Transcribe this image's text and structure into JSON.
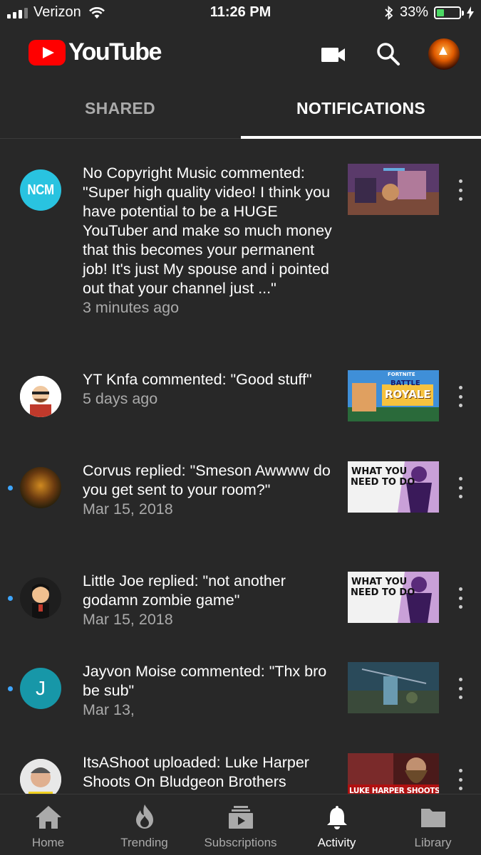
{
  "status_bar": {
    "carrier": "Verizon",
    "time": "11:26 PM",
    "battery_text": "33%",
    "battery_level": 0.33
  },
  "header": {
    "logo_text": "YouTube",
    "camera_icon": "video-camera-icon",
    "search_icon": "search-icon"
  },
  "tabs": [
    {
      "label": "SHARED",
      "active": false
    },
    {
      "label": "NOTIFICATIONS",
      "active": true
    }
  ],
  "notifications": [
    {
      "text": "No Copyright Music commented: \"Super high quality video! I think you have potential to be a HUGE YouTuber and make so much money that this becomes your permanent job! It's just My spouse and i pointed out that your channel just ...\"",
      "time": "3 minutes ago",
      "avatar_text": "NCM",
      "unread": false
    },
    {
      "text": "YT Knfa commented: \"Good stuff\"",
      "time": "5 days ago",
      "unread": false,
      "thumb_lines": [
        "FORTNITE",
        "BATTLE",
        "ROYALE"
      ]
    },
    {
      "text": "Corvus replied: \"Smeson Awwww do you get sent to your room?\"",
      "time": "Mar 15, 2018",
      "unread": true,
      "thumb_lines": [
        "WHAT YOU",
        "NEED TO DO"
      ]
    },
    {
      "text": "Little Joe replied: \"not another godamn zombie game\"",
      "time": "Mar 15, 2018",
      "unread": true,
      "thumb_lines": [
        "WHAT YOU",
        "NEED TO DO"
      ]
    },
    {
      "text": "Jayvon Moise commented: \"Thx bro be sub\"",
      "time": "Mar 13,",
      "avatar_text": "J",
      "unread": true
    },
    {
      "text": "ItsAShoot uploaded: Luke Harper Shoots On Bludgeon Brothers",
      "time": "",
      "unread": false,
      "thumb_lines": [
        "LUKE HARPER SHOOTS ON"
      ]
    }
  ],
  "bottom_nav": [
    {
      "label": "Home",
      "icon": "home-icon",
      "active": false
    },
    {
      "label": "Trending",
      "icon": "flame-icon",
      "active": false
    },
    {
      "label": "Subscriptions",
      "icon": "subscriptions-icon",
      "active": false
    },
    {
      "label": "Activity",
      "icon": "bell-icon",
      "active": true
    },
    {
      "label": "Library",
      "icon": "folder-icon",
      "active": false
    }
  ],
  "colors": {
    "background": "#282828",
    "brand_red": "#ff0000",
    "unread_dot": "#3ea6ff",
    "battery_fill": "#4cd964",
    "secondary_text": "#aaaaaa"
  }
}
